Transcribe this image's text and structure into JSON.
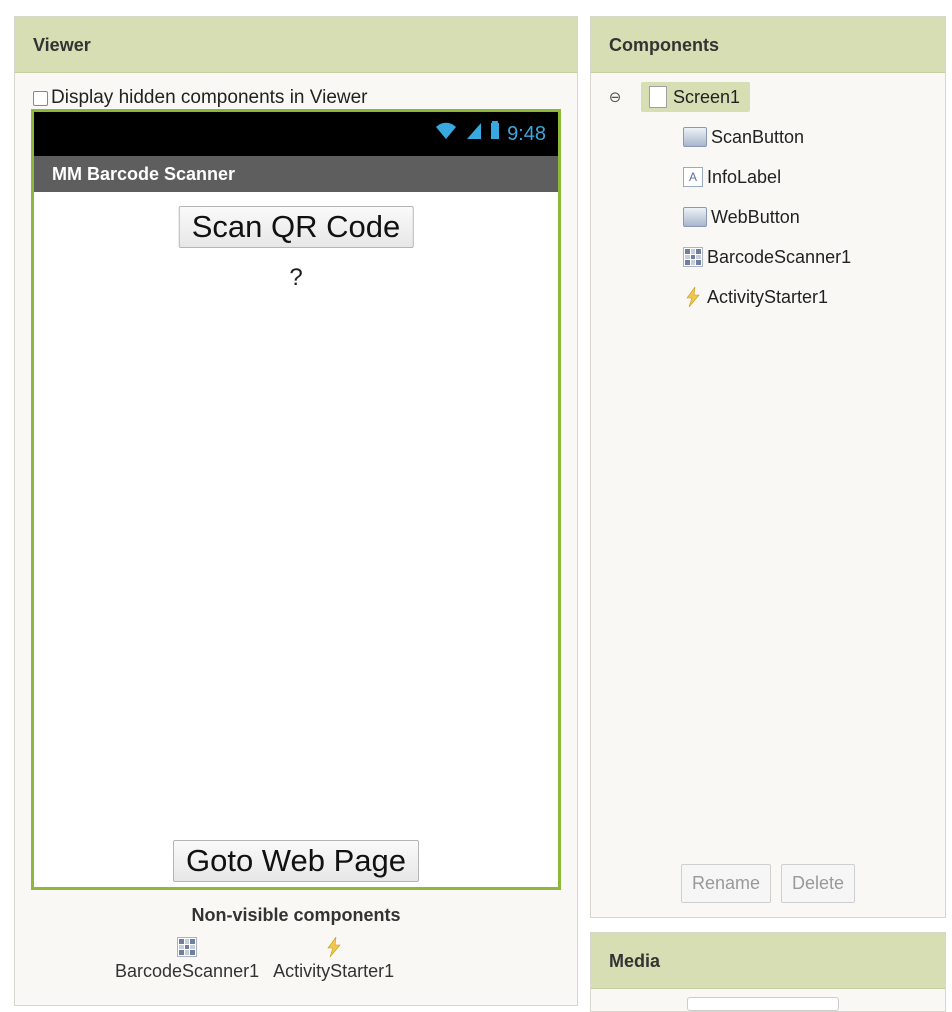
{
  "viewer": {
    "title": "Viewer",
    "hidden_toggle_label": "Display hidden components in Viewer",
    "phone": {
      "status_time": "9:48",
      "app_title": "MM Barcode Scanner",
      "scan_button_label": "Scan QR Code",
      "info_label_text": "?",
      "web_button_label": "Goto Web Page"
    },
    "nonvisible": {
      "title": "Non-visible components",
      "items": [
        {
          "label": "BarcodeScanner1",
          "icon": "barcode-scanner-icon"
        },
        {
          "label": "ActivityStarter1",
          "icon": "activity-starter-icon"
        }
      ]
    }
  },
  "components": {
    "title": "Components",
    "screen_label": "Screen1",
    "children": [
      {
        "label": "ScanButton",
        "icon": "button-icon"
      },
      {
        "label": "InfoLabel",
        "icon": "label-icon"
      },
      {
        "label": "WebButton",
        "icon": "button-icon"
      },
      {
        "label": "BarcodeScanner1",
        "icon": "barcode-scanner-icon"
      },
      {
        "label": "ActivityStarter1",
        "icon": "activity-starter-icon"
      }
    ],
    "rename_label": "Rename",
    "delete_label": "Delete"
  },
  "media": {
    "title": "Media"
  },
  "colors": {
    "header_bg": "#d7deb3",
    "phone_border": "#8fb83a",
    "status_icon": "#3aa8e0"
  }
}
